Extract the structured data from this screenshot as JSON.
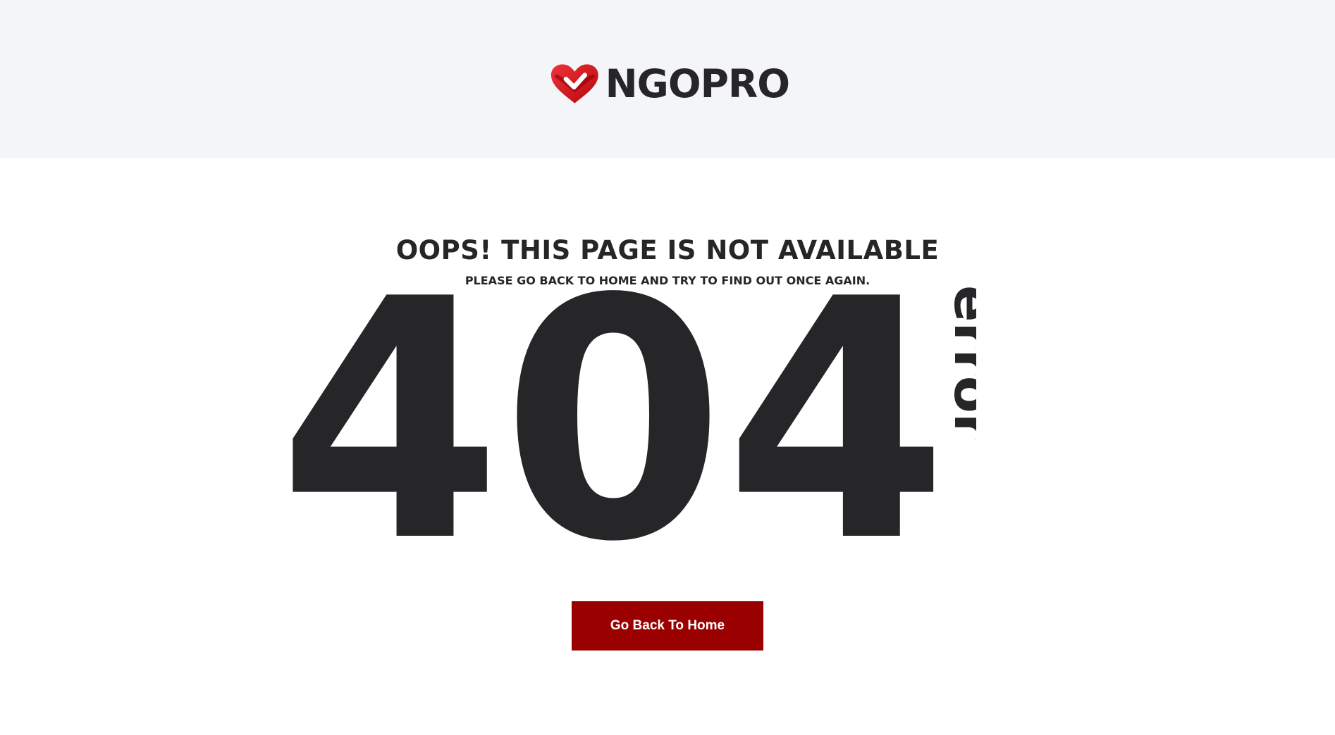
{
  "header": {
    "logo_text": "NGOPRO",
    "logo_icon": "heart-check-icon",
    "logo_color": "#d7141a"
  },
  "main": {
    "headline": "OOPS! THIS PAGE IS NOT AVAILABLE",
    "subline": "PLEASE GO BACK TO HOME AND TRY TO FIND OUT ONCE AGAIN.",
    "code": "404",
    "code_label": "error",
    "button_label": "Go Back To Home"
  },
  "colors": {
    "header_bg": "#f4f5f9",
    "text_dark": "#262628",
    "button_bg": "#9b0000",
    "button_text": "#ffffff"
  }
}
